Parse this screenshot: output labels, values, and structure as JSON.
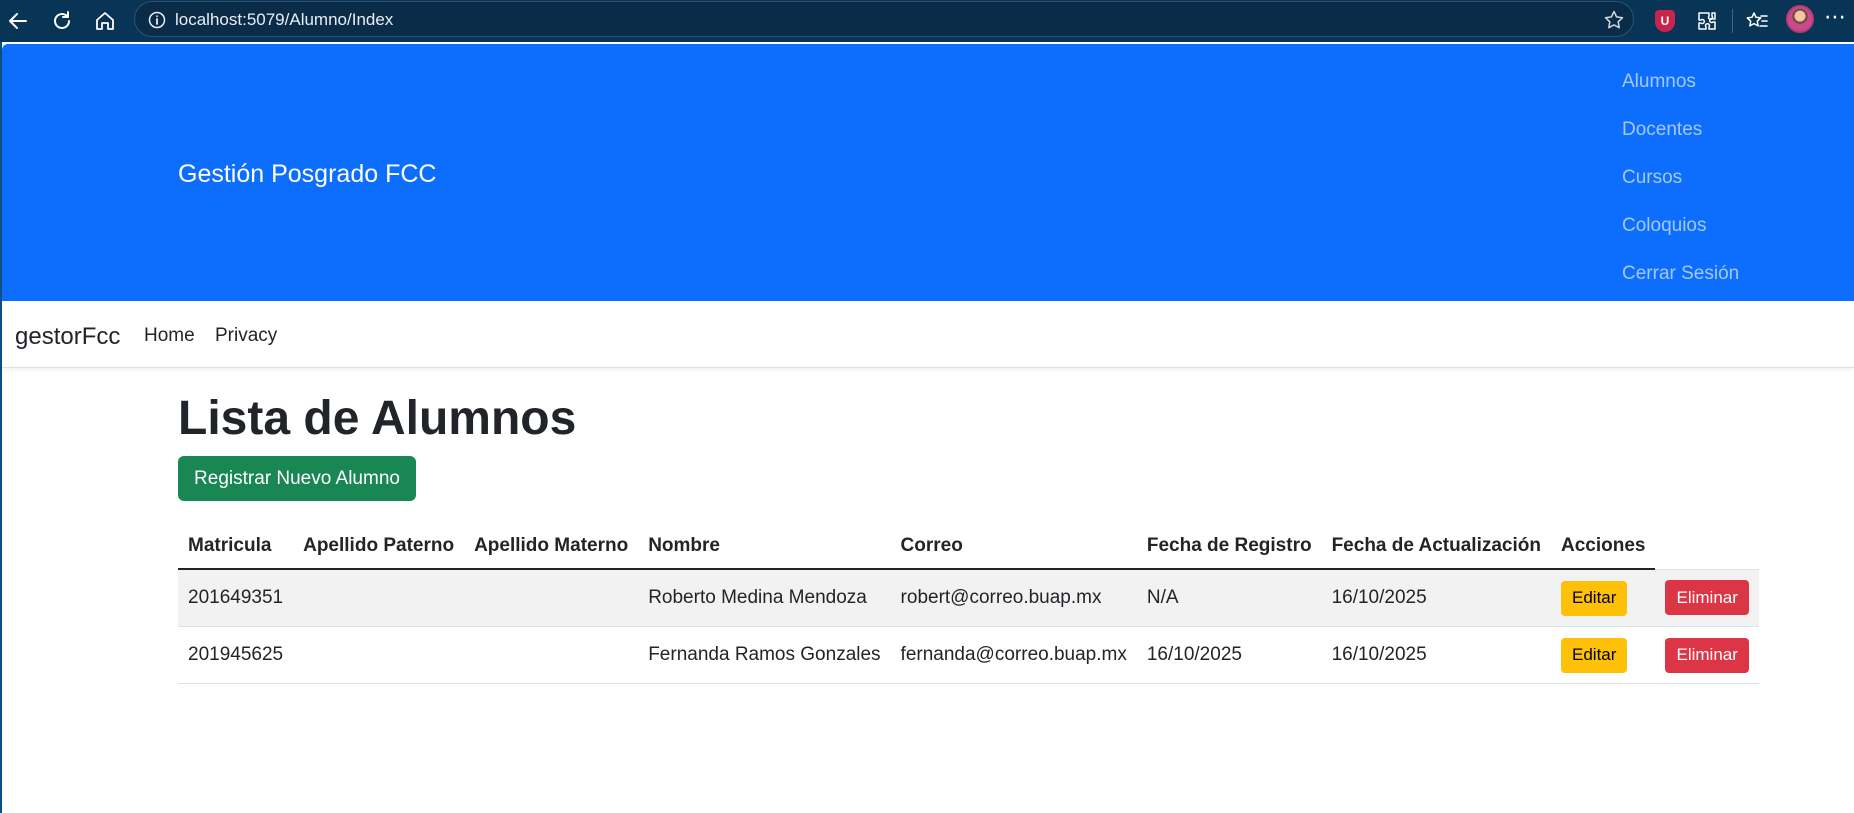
{
  "browser": {
    "url": "localhost:5079/Alumno/Index",
    "ublock_badge": "U"
  },
  "header": {
    "site_title": "Gestión Posgrado FCC",
    "menu": [
      "Alumnos",
      "Docentes",
      "Cursos",
      "Coloquios",
      "Cerrar Sesión"
    ]
  },
  "navbar": {
    "brand": "gestorFcc",
    "links": [
      "Home",
      "Privacy"
    ]
  },
  "main": {
    "title": "Lista de Alumnos",
    "new_button": "Registrar Nuevo Alumno",
    "table": {
      "columns": [
        "Matricula",
        "Apellido Paterno",
        "Apellido Materno",
        "Nombre",
        "Correo",
        "Fecha de Registro",
        "Fecha de Actualización",
        "Acciones"
      ],
      "rows": [
        [
          "201649351",
          "",
          "",
          "Roberto Medina Mendoza",
          "robert@correo.buap.mx",
          "N/A",
          "16/10/2025"
        ],
        [
          "201945625",
          "",
          "",
          "Fernanda Ramos Gonzales",
          "fernanda@correo.buap.mx",
          "16/10/2025",
          "16/10/2025"
        ]
      ],
      "edit_label": "Editar",
      "delete_label": "Eliminar"
    }
  },
  "colors": {
    "chrome_bg": "#083555",
    "header_blue": "#0d6efd",
    "success": "#198754",
    "warning": "#ffc107",
    "danger": "#dc3545"
  },
  "icons": [
    "back-arrow-icon",
    "refresh-icon",
    "home-icon",
    "info-icon",
    "star-icon",
    "ublock-icon",
    "extensions-icon",
    "favorites-icon",
    "profile-avatar",
    "more-icon"
  ]
}
